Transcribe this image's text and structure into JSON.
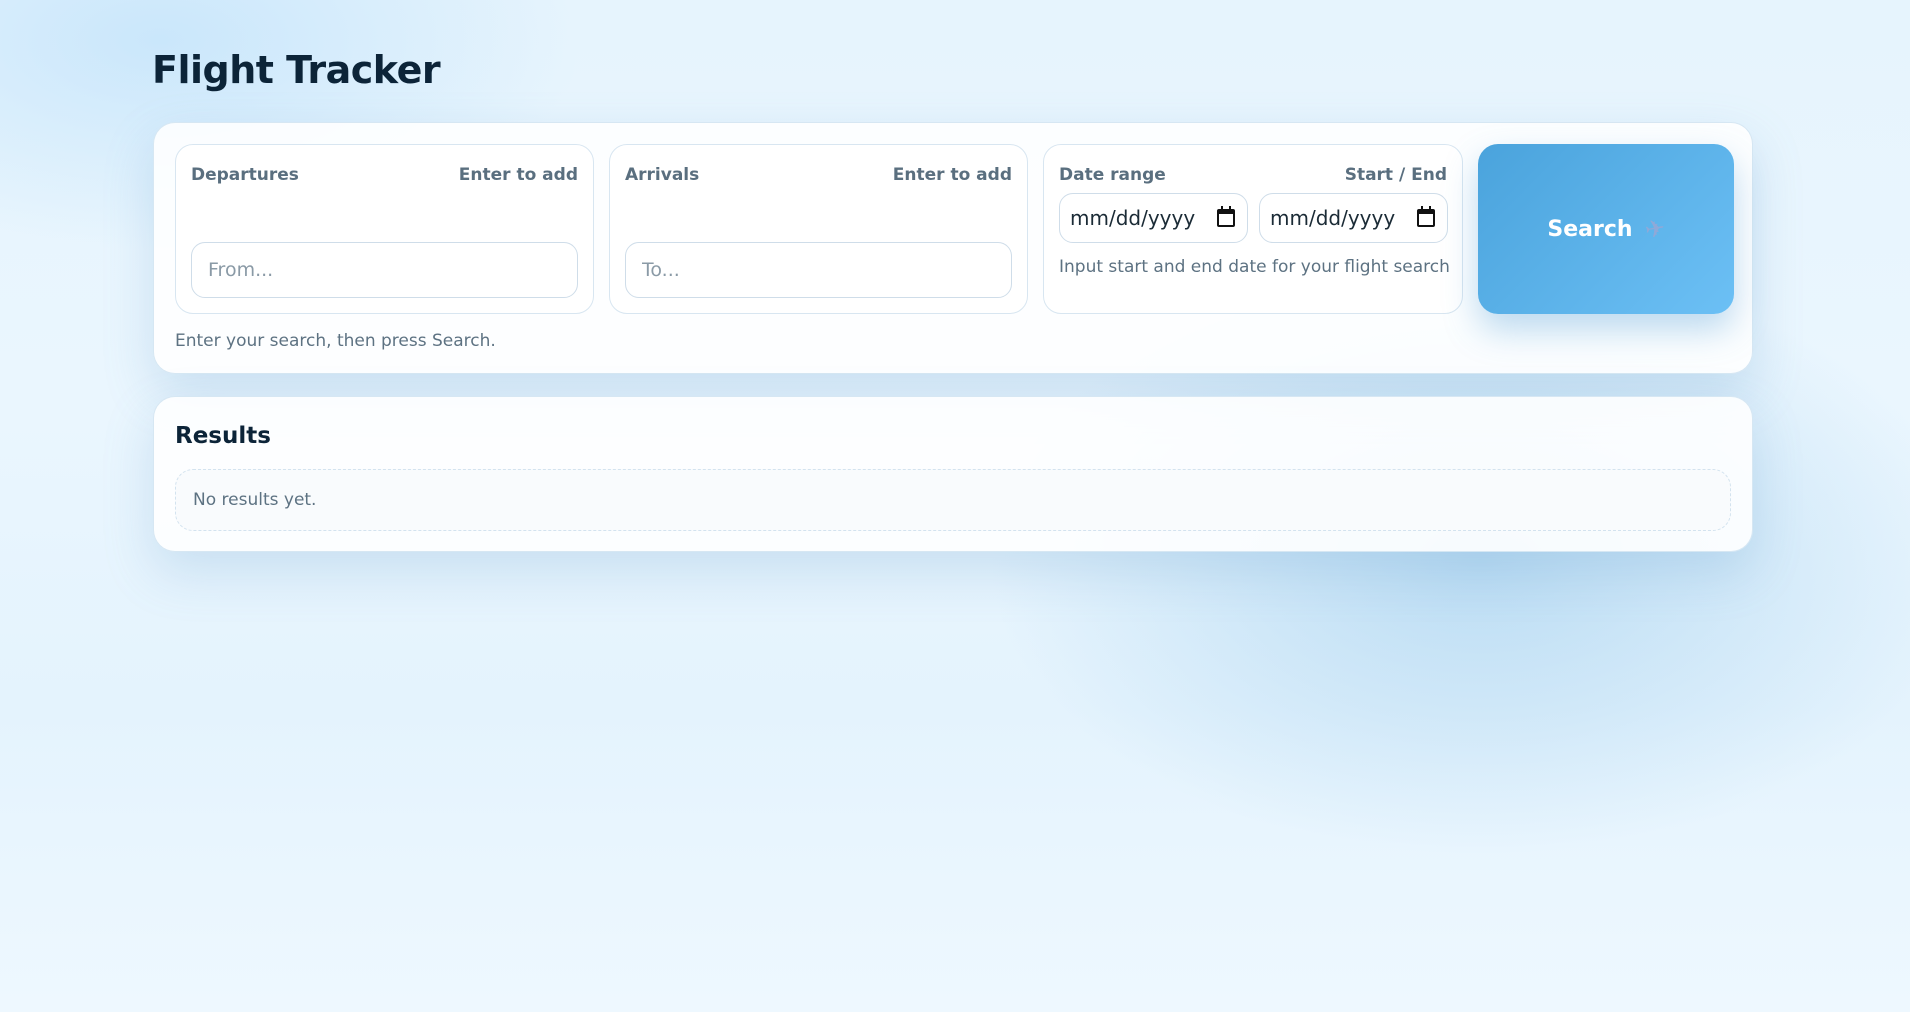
{
  "page": {
    "title": "Flight Tracker"
  },
  "search": {
    "departures": {
      "label": "Departures",
      "hint": "Enter to add",
      "placeholder": "From...",
      "value": ""
    },
    "arrivals": {
      "label": "Arrivals",
      "hint": "Enter to add",
      "placeholder": "To...",
      "value": ""
    },
    "date_range": {
      "label": "Date range",
      "hint": "Start / End",
      "start_value": "mm/dd/yyyy",
      "end_value": "mm/dd/yyyy",
      "note": "Input start and end date for your flight search"
    },
    "button": {
      "label": "Search",
      "icon": "airplane-icon"
    },
    "note": "Enter your search, then press Search."
  },
  "results": {
    "title": "Results",
    "empty_text": "No results yet."
  },
  "colors": {
    "accent": "#4aa3dc",
    "accent_light": "#6cc0f5",
    "text_dark": "#0c2438",
    "text_muted": "#5d7282"
  }
}
